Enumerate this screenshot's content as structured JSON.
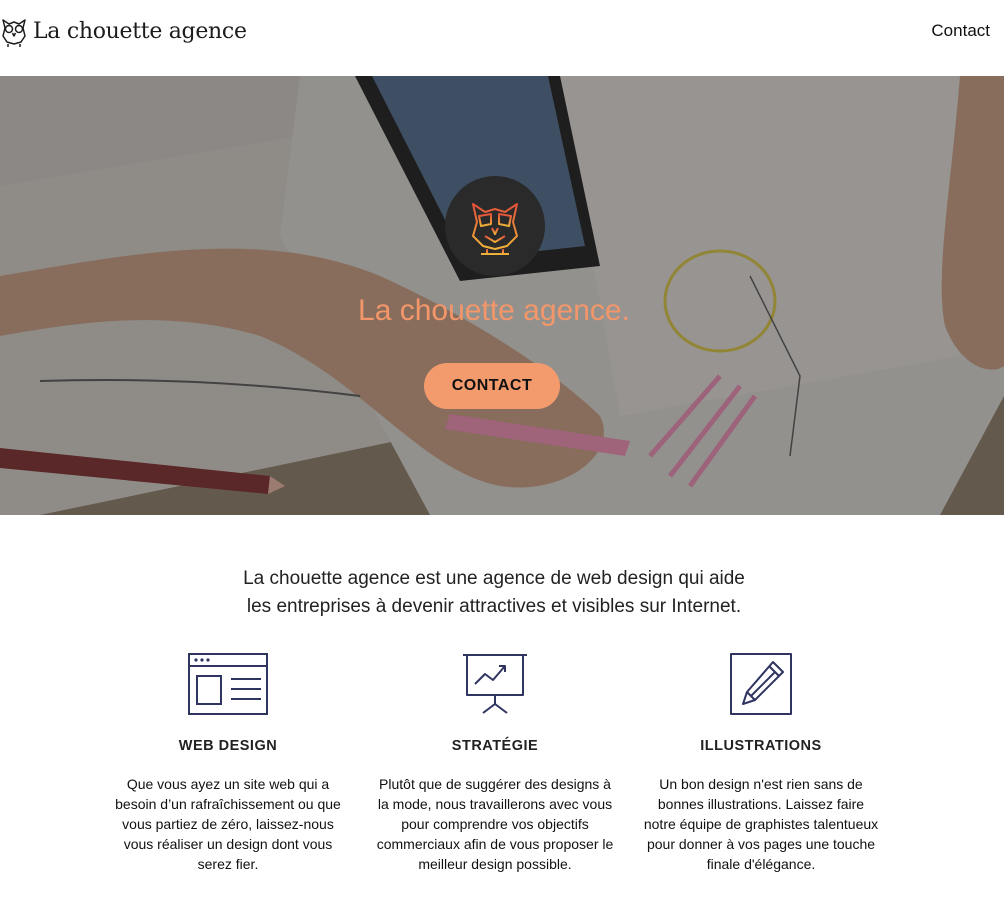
{
  "header": {
    "brand": "La chouette agence",
    "nav_contact": "Contact"
  },
  "hero": {
    "title": "La chouette agence.",
    "button_label": "CONTACT"
  },
  "intro": {
    "line1": "La chouette agence est une agence de web design qui aide",
    "line2": "les entreprises à devenir attractives et visibles sur Internet."
  },
  "services": [
    {
      "icon": "web-design-icon",
      "title": "WEB DESIGN",
      "desc": "Que vous ayez un site web qui a besoin d’un rafraîchissement ou que vous partiez de zéro, laissez-nous vous réaliser un design dont vous serez fier."
    },
    {
      "icon": "strategy-icon",
      "title": "STRATÉGIE",
      "desc": "Plutôt que de suggérer des designs à la mode, nous travaillerons avec vous pour comprendre vos objectifs commerciaux afin de vous proposer le meilleur design possible."
    },
    {
      "icon": "illustration-icon",
      "title": "ILLUSTRATIONS",
      "desc": "Un bon design n'est rien sans de bonnes illustrations. Laissez faire notre équipe de graphistes talentueux pour donner à vos pages une touche finale d'élégance."
    }
  ],
  "colors": {
    "accent": "#f39b6d",
    "icon_stroke": "#2f3460",
    "hero_title": "#f3976a"
  }
}
